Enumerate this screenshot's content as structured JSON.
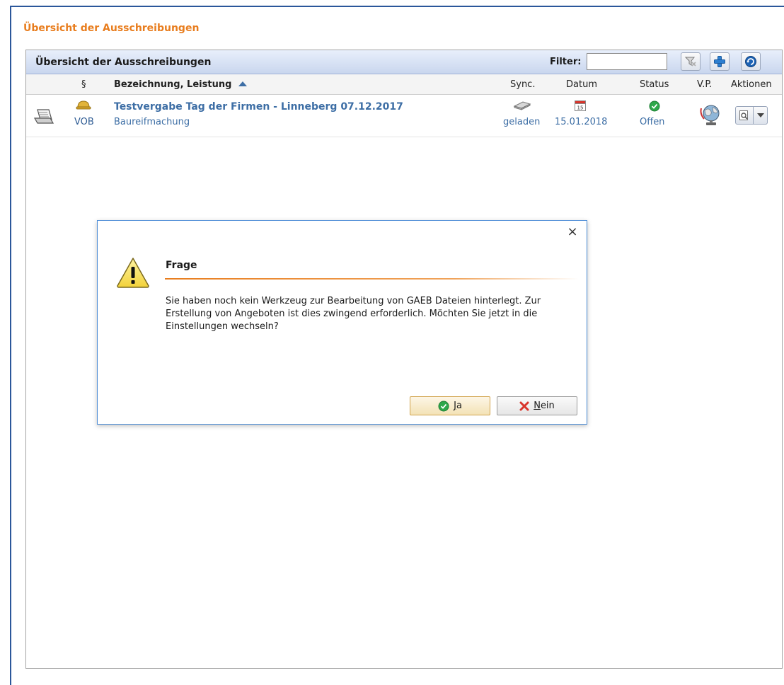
{
  "page": {
    "title": "Übersicht der Ausschreibungen"
  },
  "panel": {
    "title": "Übersicht der Ausschreibungen",
    "filter_label": "Filter:",
    "filter_value": "",
    "toolbar_icons": [
      "clear-filter-icon",
      "add-icon",
      "refresh-icon"
    ]
  },
  "columns": {
    "paragraph": "§",
    "bezeichnung": "Bezeichnung, Leistung",
    "sync": "Sync.",
    "datum": "Datum",
    "status": "Status",
    "vp": "V.P.",
    "aktionen": "Aktionen"
  },
  "rows": [
    {
      "type_label": "VOB",
      "title": "Testvergabe Tag der Firmen - Linneberg 07.12.2017",
      "subtitle": "Baureifmachung",
      "sync": "geladen",
      "datum": "15.01.2018",
      "calendar_day": "15",
      "status": "Offen"
    }
  ],
  "dialog": {
    "heading": "Frage",
    "message": "Sie haben noch kein Werkzeug zur Bearbeitung von GAEB Dateien hinterlegt. Zur Erstellung von Angeboten ist dies zwingend erforderlich. Möchten Sie jetzt in die Einstellungen wechseln?",
    "close_symbol": "×",
    "yes_mnemonic": "J",
    "yes_rest": "a",
    "no_mnemonic": "N",
    "no_rest": "ein"
  },
  "colors": {
    "accent_orange": "#e87d1e",
    "link_blue": "#3d6ea5",
    "status_green": "#2ea84a",
    "no_red": "#d9342b"
  }
}
